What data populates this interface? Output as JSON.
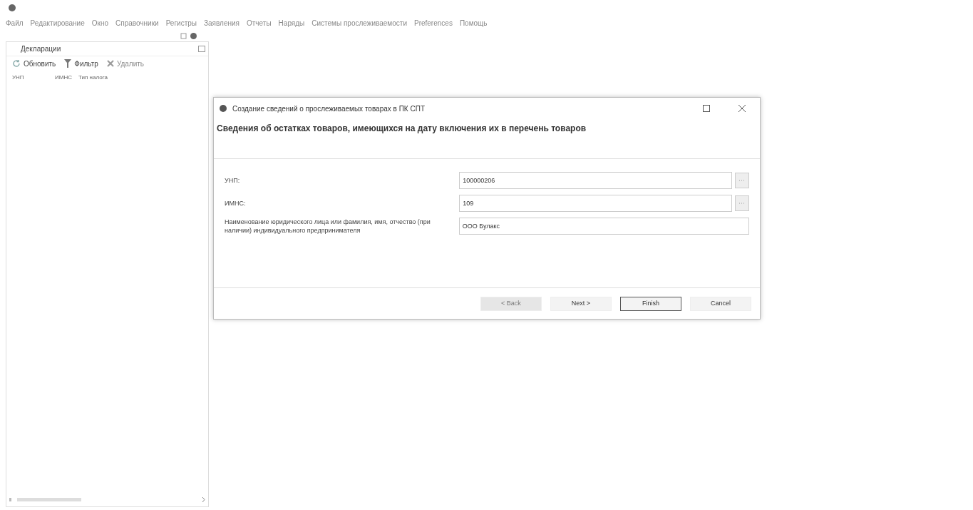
{
  "menu": [
    {
      "label": "Файл"
    },
    {
      "label": "Редактирование"
    },
    {
      "label": "Окно"
    },
    {
      "label": "Справочники"
    },
    {
      "label": "Регистры"
    },
    {
      "label": "Заявления"
    },
    {
      "label": "Отчеты"
    },
    {
      "label": "Наряды"
    },
    {
      "label": "Системы прослеживаемости"
    },
    {
      "label": "Preferences"
    },
    {
      "label": "Помощь"
    }
  ],
  "view": {
    "title": "Декларации",
    "toolbar": [
      {
        "kind": "refresh",
        "label": "Обновить",
        "disabled": false
      },
      {
        "kind": "filter",
        "label": "Фильтр",
        "disabled": false
      },
      {
        "kind": "delete",
        "label": "Удалить",
        "disabled": true
      }
    ],
    "columns": [
      "УНП",
      "ИМНС",
      "Тип налога"
    ]
  },
  "dialog": {
    "title": "Создание сведений о прослеживаемых товарах в ПК СПТ",
    "heading": "Сведения об остатках товаров, имеющихся на дату включения их в перечень товаров",
    "fields": [
      {
        "label": "УНП:",
        "value": "100000206",
        "lookup": true
      },
      {
        "label": "ИМНС:",
        "value": "109",
        "lookup": true
      },
      {
        "label": "Наименование  юридического лица или фамилия, имя, отчество (при наличии) индивидуального предпринимателя",
        "value": "ООО Булакс",
        "lookup": false
      }
    ],
    "buttons": [
      {
        "label": "< Back",
        "disabled": true,
        "default": false
      },
      {
        "label": "Next >",
        "disabled": false,
        "default": false
      },
      {
        "label": "Finish",
        "disabled": false,
        "default": true
      },
      {
        "label": "Cancel",
        "disabled": false,
        "default": false
      }
    ]
  }
}
